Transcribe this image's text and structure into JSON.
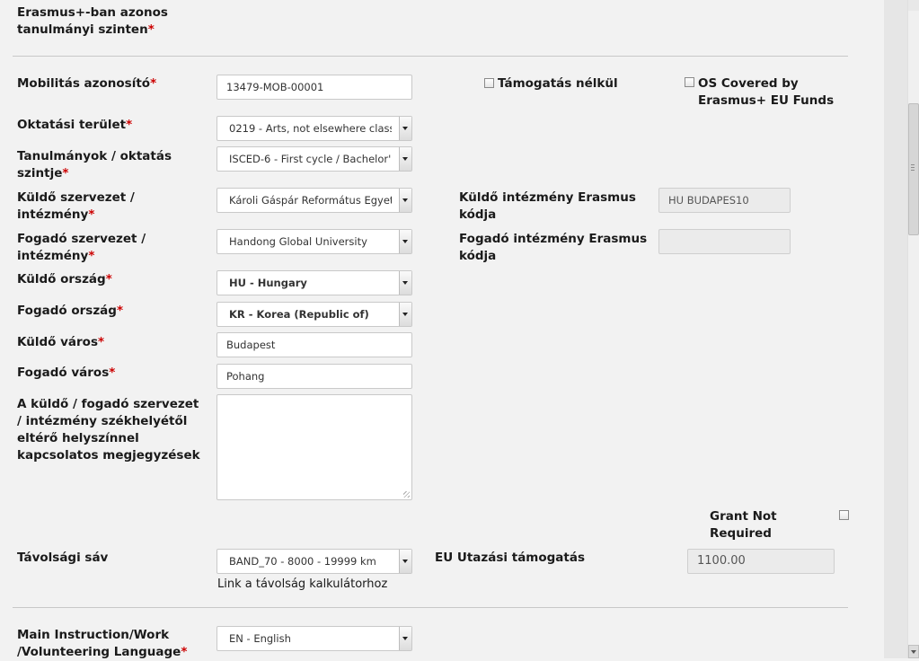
{
  "top_label": {
    "line1": "Erasmus+-ban azonos",
    "line2": "tanulmányi szinten"
  },
  "mobility_id": {
    "label": "Mobilitás azonosító",
    "value": "13479-MOB-00001"
  },
  "no_grant": {
    "label": "Támogatás nélkül"
  },
  "os_covered": {
    "line1": "OS Covered by",
    "line2": "Erasmus+ EU Funds"
  },
  "field_of_education": {
    "label": "Oktatási terület",
    "value": "0219 - Arts, not elsewhere class"
  },
  "study_level": {
    "line1": "Tanulmányok / oktatás",
    "line2": "szintje",
    "value": "ISCED-6 - First cycle / Bachelor'"
  },
  "sending_org": {
    "line1": "Küldő szervezet /",
    "line2": "intézmény",
    "value": "Károli Gáspár Református Egyeter"
  },
  "sending_erasmus_code": {
    "line1": "Küldő intézmény Erasmus",
    "line2": "kódja",
    "value": "HU BUDAPES10"
  },
  "receiving_org": {
    "line1": "Fogadó szervezet /",
    "line2": "intézmény",
    "value": "Handong Global University"
  },
  "receiving_erasmus_code": {
    "line1": "Fogadó intézmény Erasmus",
    "line2": "kódja",
    "value": ""
  },
  "sending_country": {
    "label": "Küldő ország",
    "value": "HU - Hungary"
  },
  "receiving_country": {
    "label": "Fogadó ország",
    "value": "KR - Korea (Republic of)"
  },
  "sending_city": {
    "label": "Küldő város",
    "value": "Budapest"
  },
  "receiving_city": {
    "label": "Fogadó város",
    "value": "Pohang"
  },
  "remarks": {
    "line1": "A küldő / fogadó szervezet",
    "line2": "/ intézmény székhelyétől",
    "line3": "eltérő helyszínnel",
    "line4": "kapcsolatos megjegyzések",
    "value": ""
  },
  "grant_not_required": {
    "line1": "Grant Not",
    "line2": "Required"
  },
  "distance_band": {
    "label": "Távolsági sáv",
    "value": "BAND_70 - 8000 - 19999 km"
  },
  "distance_calc_link": "Link a távolság kalkulátorhoz",
  "eu_travel_grant": {
    "label": "EU Utazási támogatás",
    "value": "1100.00"
  },
  "main_language": {
    "line1": "Main Instruction/Work",
    "line2": "/Volunteering Language",
    "value": "EN - English"
  },
  "required_mark": "*"
}
